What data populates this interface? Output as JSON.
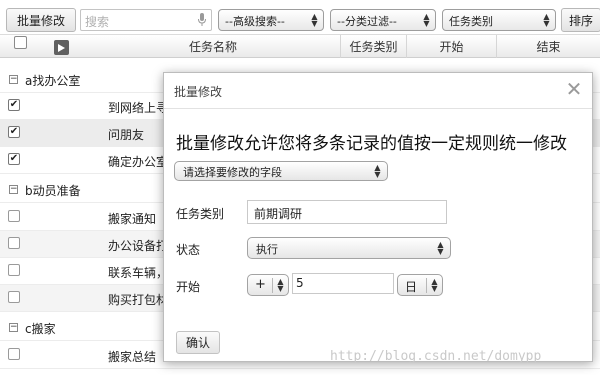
{
  "toolbar": {
    "batch_edit_label": "批量修改",
    "search_placeholder": "搜索",
    "advanced_search": "--高级搜索--",
    "category_filter": "--分类过滤--",
    "task_type": "任务类别",
    "sort_label": "排序"
  },
  "grid": {
    "columns": [
      "任务名称",
      "任务类别",
      "开始",
      "结束"
    ],
    "groups": [
      {
        "label": "a找办公室",
        "toggle": "⊟",
        "tasks": [
          {
            "name": "到网络上寻",
            "checked": true
          },
          {
            "name": "问朋友",
            "checked": true
          },
          {
            "name": "确定办公室",
            "checked": true
          }
        ]
      },
      {
        "label": "b动员准备",
        "toggle": "⊟",
        "tasks": [
          {
            "name": "搬家通知",
            "checked": false
          },
          {
            "name": "办公设备打",
            "checked": false
          },
          {
            "name": "联系车辆，",
            "checked": false
          },
          {
            "name": "购买打包材",
            "checked": false
          }
        ]
      },
      {
        "label": "c搬家",
        "toggle": "⊟",
        "tasks": [
          {
            "name": "搬家总结",
            "checked": false
          }
        ]
      }
    ]
  },
  "modal": {
    "title": "批量修改",
    "heading": "批量修改允许您将多条记录的值按一定规则统一修改",
    "field_select": "请选择要修改的字段",
    "task_type_label": "任务类别",
    "task_type_value": "前期调研",
    "status_label": "状态",
    "status_value": "执行",
    "start_label": "开始",
    "start_operator": "+",
    "start_amount": "5",
    "start_unit": "日",
    "confirm_label": "确认"
  },
  "watermark": "http://blog.csdn.net/domypp"
}
